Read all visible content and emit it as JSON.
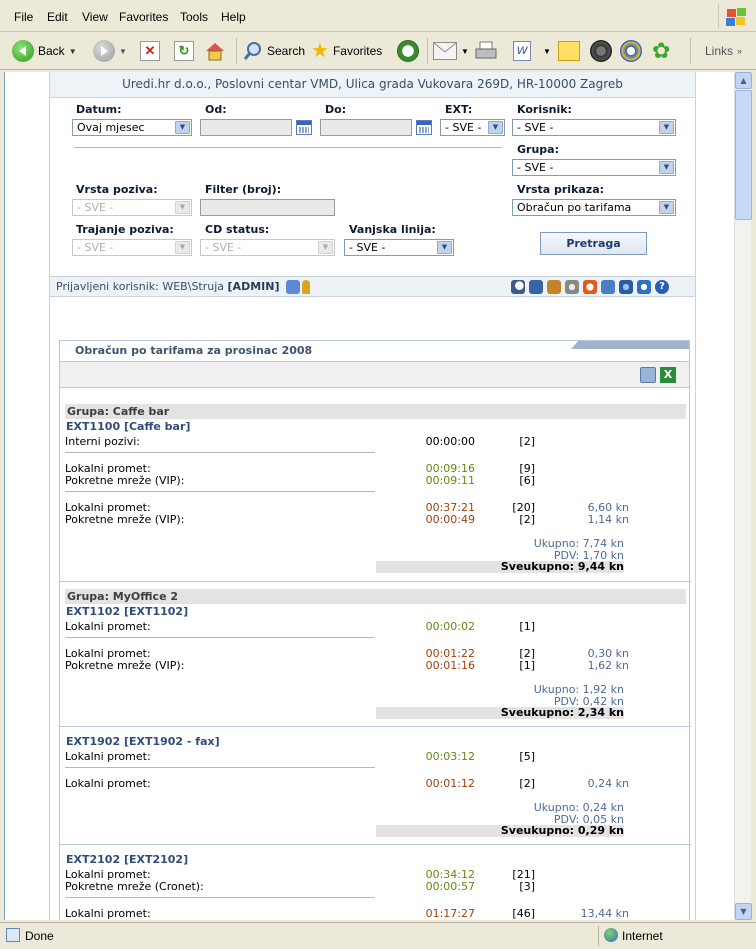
{
  "menu": {
    "items": [
      "File",
      "Edit",
      "View",
      "Favorites",
      "Tools",
      "Help"
    ]
  },
  "toolbar": {
    "back": "Back",
    "search": "Search",
    "favorites": "Favorites",
    "links": "Links"
  },
  "status": {
    "text": "Done",
    "zone": "Internet"
  },
  "colors": {
    "accent": "#3d5573",
    "green": "#5e8c10",
    "brown": "#a0400c"
  },
  "page": {
    "company": "Uredi.hr d.o.o., Poslovni centar VMD, Ulica grada Vukovara 269D, HR-10000 Zagreb",
    "filters": {
      "datum_label": "Datum:",
      "datum_value": "Ovaj mjesec",
      "od_label": "Od:",
      "do_label": "Do:",
      "ext_label": "EXT:",
      "ext_value": "- SVE -",
      "korisnik_label": "Korisnik:",
      "korisnik_value": "- SVE -",
      "grupa_label": "Grupa:",
      "grupa_value": "- SVE -",
      "vrsta_poziva_label": "Vrsta poziva:",
      "vrsta_poziva_value": "- SVE -",
      "filter_label": "Filter (broj):",
      "vrsta_prikaza_label": "Vrsta prikaza:",
      "vrsta_prikaza_value": "Obračun po tarifama",
      "trajanje_label": "Trajanje poziva:",
      "trajanje_value": "- SVE -",
      "cd_label": "CD status:",
      "cd_value": "- SVE -",
      "vanjska_label": "Vanjska linija:",
      "vanjska_value": "- SVE -",
      "pretraga": "Pretraga"
    },
    "user": {
      "prefix": "Prijavljeni korisnik:",
      "name": "WEB\\Struja",
      "role": "[ADMIN]"
    },
    "report": {
      "title": "Obračun po tarifama za prosinac 2008",
      "groups": [
        {
          "name": "Grupa: Caffe bar"
        },
        {
          "name": "Grupa: MyOffice 2"
        }
      ],
      "exts": [
        {
          "name": "EXT1100 [Caffe bar]",
          "ukupno": "Ukupno: 7,74 kn",
          "pdv": "PDV: 1,70 kn",
          "sveukupno": "Sveukupno: 9,44 kn"
        },
        {
          "name": "EXT1102 [EXT1102]",
          "ukupno": "Ukupno: 1,92 kn",
          "pdv": "PDV: 0,42 kn",
          "sveukupno": "Sveukupno: 2,34 kn"
        },
        {
          "name": "EXT1902 [EXT1902 - fax]",
          "ukupno": "Ukupno: 0,24 kn",
          "pdv": "PDV: 0,05 kn",
          "sveukupno": "Sveukupno: 0,29 kn"
        },
        {
          "name": "EXT2102 [EXT2102]"
        }
      ],
      "rows": [
        {
          "label": "Interni pozivi:",
          "time": "00:00:00",
          "count": "[2]",
          "amount": ""
        },
        {
          "label": "Lokalni promet:",
          "time": "00:09:16",
          "count": "[9]",
          "amount": ""
        },
        {
          "label": "Pokretne mreže (VIP):",
          "time": "00:09:11",
          "count": "[6]",
          "amount": ""
        },
        {
          "label": "Lokalni promet:",
          "time": "00:37:21",
          "count": "[20]",
          "amount": "6,60 kn"
        },
        {
          "label": "Pokretne mreže (VIP):",
          "time": "00:00:49",
          "count": "[2]",
          "amount": "1,14 kn"
        },
        {
          "label": "Lokalni promet:",
          "time": "00:00:02",
          "count": "[1]",
          "amount": ""
        },
        {
          "label": "Lokalni promet:",
          "time": "00:01:22",
          "count": "[2]",
          "amount": "0,30 kn"
        },
        {
          "label": "Pokretne mreže (VIP):",
          "time": "00:01:16",
          "count": "[1]",
          "amount": "1,62 kn"
        },
        {
          "label": "Lokalni promet:",
          "time": "00:03:12",
          "count": "[5]",
          "amount": ""
        },
        {
          "label": "Lokalni promet:",
          "time": "00:01:12",
          "count": "[2]",
          "amount": "0,24 kn"
        },
        {
          "label": "Lokalni promet:",
          "time": "00:34:12",
          "count": "[21]",
          "amount": ""
        },
        {
          "label": "Pokretne mreže (Cronet):",
          "time": "00:00:57",
          "count": "[3]",
          "amount": ""
        },
        {
          "label": "Lokalni promet:",
          "time": "01:17:27",
          "count": "[46]",
          "amount": "13,44 kn"
        }
      ]
    }
  }
}
